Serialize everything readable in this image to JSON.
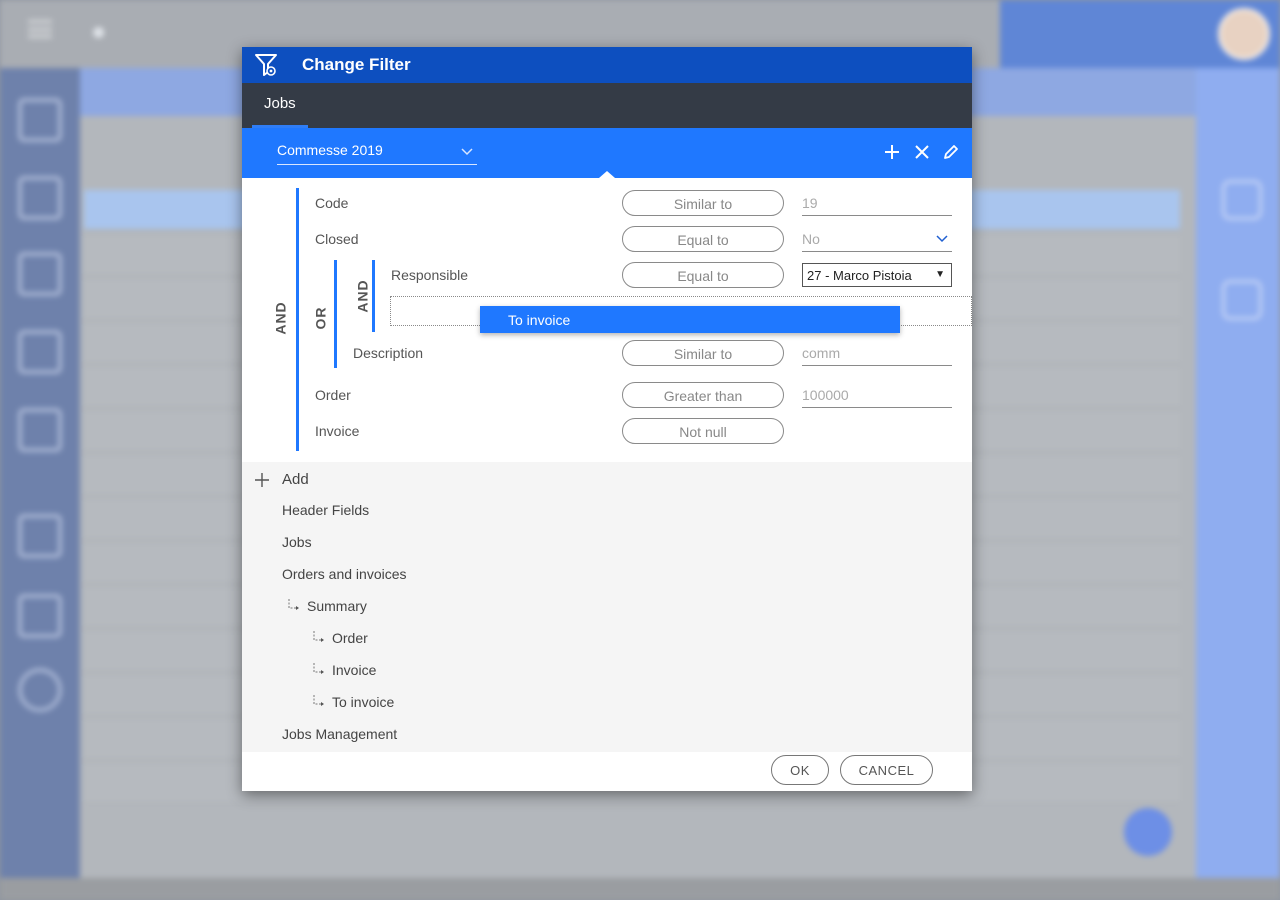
{
  "dialog": {
    "title": "Change Filter",
    "tab": "Jobs",
    "filter_name": "Commesse 2019",
    "groups": {
      "outer": "AND",
      "or_group": "OR",
      "inner": "AND"
    },
    "conditions": [
      {
        "field": "Code",
        "operator": "Similar to",
        "value": "19"
      },
      {
        "field": "Closed",
        "operator": "Equal to",
        "value": "No"
      },
      {
        "field": "Responsible",
        "operator": "Equal to",
        "value": "27 - Marco Pistoia"
      },
      {
        "field": "Description",
        "operator": "Similar to",
        "value": "comm"
      },
      {
        "field": "Order",
        "operator": "Greater than",
        "value": "100000"
      },
      {
        "field": "Invoice",
        "operator": "Not null",
        "value": ""
      }
    ],
    "dropdown_item": "To invoice",
    "add_label": "Add",
    "tree": [
      "Header Fields",
      "Jobs",
      "Orders and invoices",
      "Summary",
      "Order",
      "Invoice",
      "To invoice",
      "Jobs Management"
    ],
    "ok_label": "OK",
    "cancel_label": "CANCEL",
    "accent_color": "#1f78ff",
    "title_bar_color": "#0d4fbf"
  }
}
